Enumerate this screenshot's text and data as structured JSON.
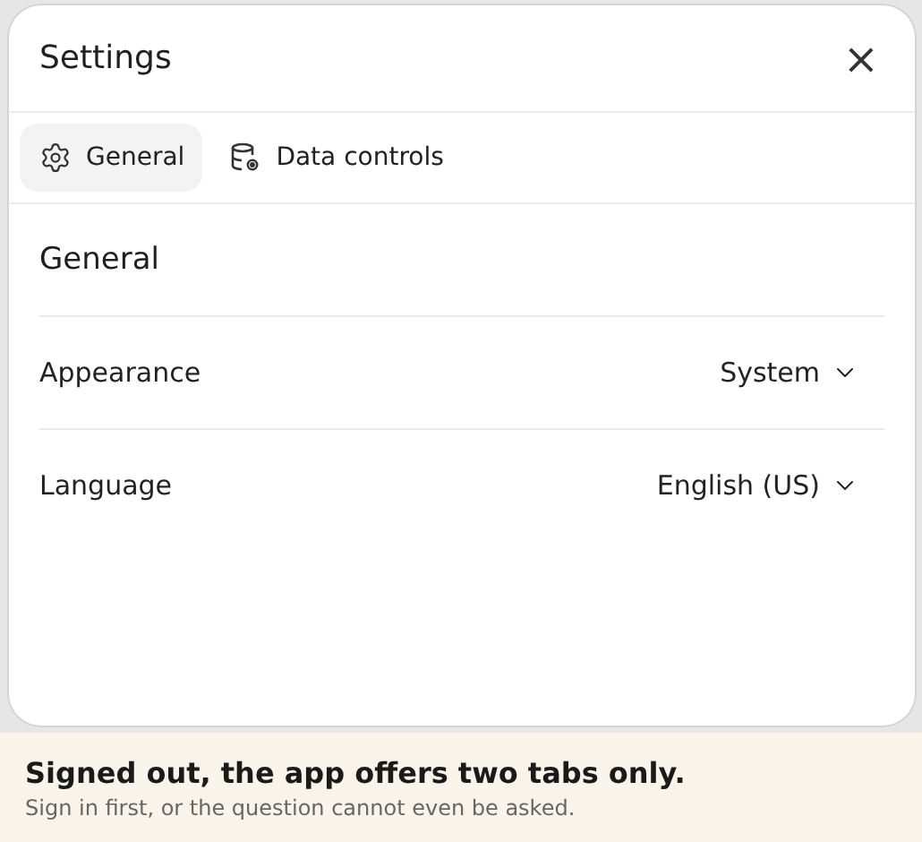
{
  "dialog": {
    "title": "Settings",
    "close": "×"
  },
  "tabs": [
    {
      "label": "General",
      "kind": "gear",
      "selected": true
    },
    {
      "label": "Data controls",
      "kind": "database",
      "selected": false
    }
  ],
  "section": {
    "heading": "General"
  },
  "rows": [
    {
      "label": "Appearance",
      "value": "System"
    },
    {
      "label": "Language",
      "value": "English (US)"
    }
  ],
  "caption": {
    "headline": "Signed out, the app offers two tabs only.",
    "note": "Sign in first, or the question cannot even be asked."
  }
}
